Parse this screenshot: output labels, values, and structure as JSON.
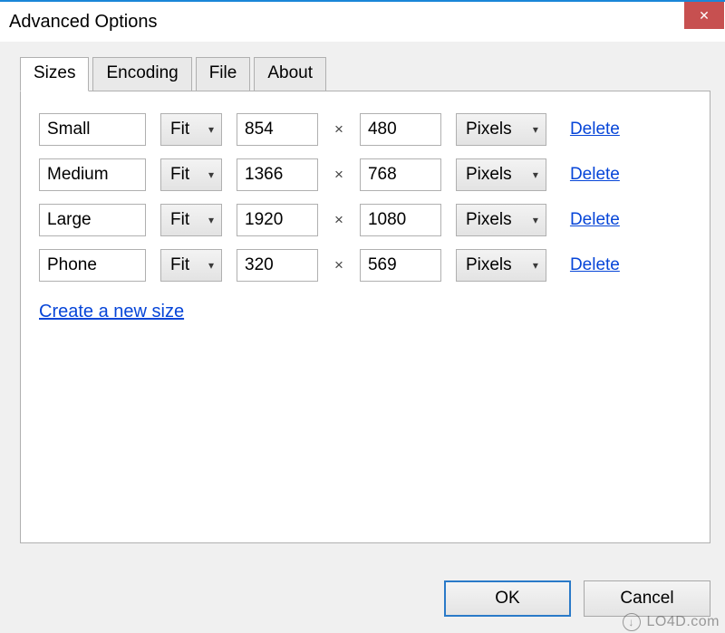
{
  "window": {
    "title": "Advanced Options",
    "close_icon": "✕"
  },
  "tabs": [
    {
      "label": "Sizes",
      "active": true
    },
    {
      "label": "Encoding",
      "active": false
    },
    {
      "label": "File",
      "active": false
    },
    {
      "label": "About",
      "active": false
    }
  ],
  "size_rows": [
    {
      "name": "Small",
      "fit": "Fit",
      "width": "854",
      "height": "480",
      "unit": "Pixels",
      "delete": "Delete"
    },
    {
      "name": "Medium",
      "fit": "Fit",
      "width": "1366",
      "height": "768",
      "unit": "Pixels",
      "delete": "Delete"
    },
    {
      "name": "Large",
      "fit": "Fit",
      "width": "1920",
      "height": "1080",
      "unit": "Pixels",
      "delete": "Delete"
    },
    {
      "name": "Phone",
      "fit": "Fit",
      "width": "320",
      "height": "569",
      "unit": "Pixels",
      "delete": "Delete"
    }
  ],
  "times_symbol": "×",
  "create_link": "Create a new size",
  "buttons": {
    "ok": "OK",
    "cancel": "Cancel"
  },
  "watermark": "LO4D.com"
}
